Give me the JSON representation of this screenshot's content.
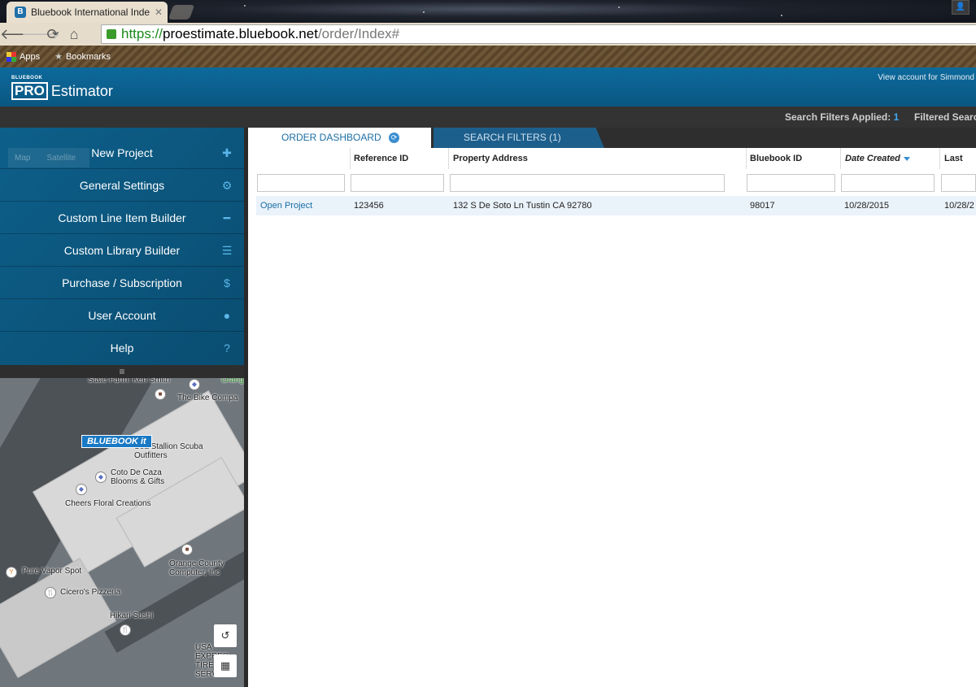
{
  "browser": {
    "tab_title": "Bluebook International Inde",
    "tab_favicon": "B",
    "url_scheme": "https://",
    "url_host": "proestimate.bluebook.net",
    "url_path": "/order/Index#",
    "bookmarks": [
      {
        "label": "Apps",
        "icon": "apps-grid-icon"
      },
      {
        "label": "Bookmarks",
        "icon": "star-icon"
      }
    ]
  },
  "header": {
    "logo_brand": "BLUEBOOK",
    "logo_pro": "PRO",
    "logo_name": "Estimator",
    "view_account": "View account for Simmond"
  },
  "filterbar": {
    "applied_label": "Search Filters Applied:",
    "applied_count": "1",
    "filtered_label": "Filtered Searc"
  },
  "sidebar": {
    "map_ghost": [
      "Map",
      "Satellite"
    ],
    "items": [
      {
        "label": "New Project",
        "icon": "plus-icon"
      },
      {
        "label": "General Settings",
        "icon": "gear-icon"
      },
      {
        "label": "Custom Line Item Builder",
        "icon": "minus-icon"
      },
      {
        "label": "Custom Library Builder",
        "icon": "list-icon"
      },
      {
        "label": "Purchase / Subscription",
        "icon": "dollar-icon"
      },
      {
        "label": "User Account",
        "icon": "user-icon"
      },
      {
        "label": "Help",
        "icon": "question-icon"
      }
    ],
    "handle": "≡"
  },
  "map": {
    "badge": "BLUEBOOK it",
    "labels": [
      "State Farm: Ken Smith",
      "The Bike Compa",
      "Sea Stallion Scuba Outfitters",
      "Coto De Caza Blooms & Gifts",
      "Cheers Floral Creations",
      "Orange County Computer, Inc",
      "Pure Vapor Spot",
      "Cicero's Pizzeria",
      "Hikari Sushi",
      "USA EXPRES TIRE & SERV",
      "Orang"
    ]
  },
  "main": {
    "tabs": [
      {
        "label": "ORDER DASHBOARD",
        "active": true
      },
      {
        "label": "SEARCH FILTERS (1)",
        "active": false
      }
    ],
    "columns": [
      "",
      "Reference ID",
      "Property Address",
      "Bluebook ID",
      "Date Created",
      "Last Up"
    ],
    "sorted_column": "Date Created",
    "rows": [
      {
        "action": "Open Project",
        "reference_id": "123456",
        "property_address": "132 S De Soto Ln Tustin CA 92780",
        "bluebook_id": "98017",
        "date_created": "10/28/2015",
        "last_updated": "10/28/2"
      }
    ]
  },
  "colors": {
    "header_blue": "#0d6a9c",
    "accent_blue": "#3fa9f5",
    "link_blue": "#1b6ea5",
    "row_highlight": "#eaf2fa"
  }
}
